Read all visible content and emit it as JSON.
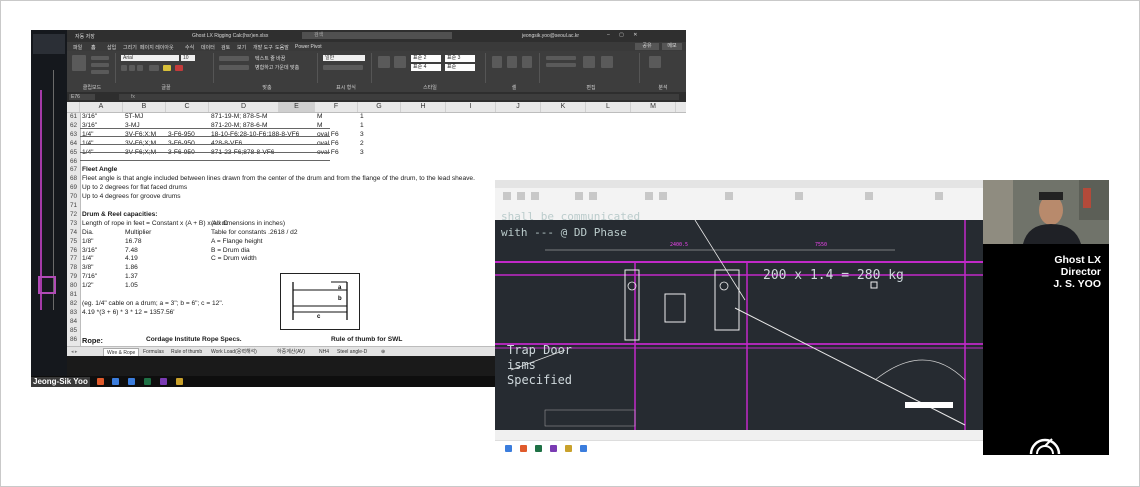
{
  "excel": {
    "window_title": "Ghost LX Rigging Calc(hsr)en.xlsx",
    "search_placeholder": "검색",
    "account": "jeongsik.yoo@seoul.ac.kr",
    "autosave": "자동 저장",
    "menu": [
      "파일",
      "홈",
      "삽입",
      "그리기",
      "페이지 레이아웃",
      "수식",
      "데이터",
      "검토",
      "보기",
      "개발 도구",
      "도움말",
      "Power Pivot"
    ],
    "share": "공유",
    "comment": "메모",
    "ribbon": {
      "clipboard": "클립보드",
      "paste": "붙여넣기",
      "font_group": "글꼴",
      "font_name": "Arial",
      "font_size": "10",
      "align_group": "맞춤",
      "wrap": "텍스트 줄 바꿈",
      "merge": "병합하고 가운데 맞춤",
      "number_group": "표시 형식",
      "number_format": "일반",
      "style_group": "스타일",
      "cond_format": "조건부 서식",
      "table_format": "표 서식",
      "styles": [
        "표준 2",
        "표준 3",
        "표준 4",
        "표준"
      ],
      "cells_group": "셀",
      "insert": "삽입",
      "delete": "삭제",
      "format": "서식",
      "edit_group": "편집",
      "sort": "정렬 및 필터",
      "find": "찾기 및 선택",
      "analysis": "분석",
      "data_analysis": "데이터 분석"
    },
    "name_box": "E76",
    "columns": [
      "A",
      "B",
      "C",
      "D",
      "E",
      "F",
      "G",
      "H",
      "I",
      "J",
      "K",
      "L",
      "M"
    ],
    "selected_column": "E",
    "rows": [
      {
        "n": "61",
        "cells": [
          "3/16\"",
          "5T-MJ",
          "",
          "871-19-M; 878-5-M",
          "",
          "M",
          "1"
        ]
      },
      {
        "n": "62",
        "cells": [
          "3/16\"",
          "3-MJ",
          "",
          "871-20-M; 878-6-M",
          "",
          "M",
          "1"
        ]
      },
      {
        "n": "63",
        "cells": [
          "1/4\"",
          "3V-F6;X;M",
          "3-F6-950",
          "18-10-F6;28-10-F6;188-8-VF6",
          "",
          "oval F6",
          "3"
        ]
      },
      {
        "n": "64",
        "cells": [
          "1/4\"",
          "3V-F6;X;M",
          "3-F6-950",
          "428-8-VF6",
          "",
          "oval F6",
          "2"
        ]
      },
      {
        "n": "65",
        "cells": [
          "1/4\"",
          "3V-F6;X;M",
          "3-F6-950",
          "871-23-F6;878-8-VF6",
          "",
          "oval F6",
          "3"
        ]
      },
      {
        "n": "66",
        "cells": []
      },
      {
        "n": "67",
        "cells": [
          "Fleet Angle"
        ]
      },
      {
        "n": "68",
        "cells": [
          "Fleet angle is that angle included between lines drawn from the center of the drum and from the flange of the drum, to the lead sheave."
        ]
      },
      {
        "n": "69",
        "cells": [
          "Up to 2 degrees for flat faced drums"
        ]
      },
      {
        "n": "70",
        "cells": [
          "Up to 4 degrees for groove drums"
        ]
      },
      {
        "n": "71",
        "cells": []
      },
      {
        "n": "72",
        "cells": [
          "Drum & Reel capacities:"
        ]
      },
      {
        "n": "73",
        "cells": [
          "Length of rope in feet = Constant x (A + B) x A x C",
          "",
          "",
          "(all dimensions in inches)"
        ]
      },
      {
        "n": "74",
        "cells": [
          "Dia.",
          "Multiplier",
          "",
          "Table for constants .2618 / d2"
        ]
      },
      {
        "n": "75",
        "cells": [
          "1/8\"",
          "16.78",
          "",
          "A = Flange height"
        ]
      },
      {
        "n": "76",
        "cells": [
          "3/16\"",
          "7.48",
          "",
          "B = Drum dia"
        ]
      },
      {
        "n": "77",
        "cells": [
          "1/4\"",
          "4.19",
          "",
          "C = Drum width"
        ]
      },
      {
        "n": "78",
        "cells": [
          "3/8\"",
          "1.86"
        ]
      },
      {
        "n": "79",
        "cells": [
          "7/16\"",
          "1.37"
        ]
      },
      {
        "n": "80",
        "cells": [
          "1/2\"",
          "1.05"
        ]
      },
      {
        "n": "81",
        "cells": []
      },
      {
        "n": "82",
        "cells": [
          "(eg. 1/4\" cable on a drum; a = 3\"; b = 6\"; c = 12\"."
        ]
      },
      {
        "n": "83",
        "cells": [
          "4.19 *(3 + 6) * 3 * 12 = 1357.56'"
        ]
      },
      {
        "n": "84",
        "cells": []
      },
      {
        "n": "85",
        "cells": []
      },
      {
        "n": "86",
        "cells": [
          "Rope:",
          "Cordage Institute Rope Specs.",
          "",
          "Rule of thumb for SWL"
        ]
      }
    ],
    "drum_labels": {
      "a": "a",
      "b": "b",
      "c": "c"
    },
    "sheet_tabs": [
      "Wire & Rope",
      "Formulas",
      "Rule of thumb",
      "Work Load(응력해석)",
      "하중계산(AV)",
      "NH4",
      "Steel angle-D",
      "⊕"
    ],
    "active_sheet": "Wire & Rope"
  },
  "left_participant": {
    "name": "Jeong-Sik Yoo"
  },
  "cad": {
    "note_top_line1": "shall be communicated",
    "note_top_line2": "with --- @ DD Phase",
    "dimension_label": "200 x 1.4 = 280 kg",
    "dim_top_1": "2400.5",
    "dim_top_2": "7550",
    "note_left_1": "Trap Door",
    "note_left_2": "isms",
    "note_left_3": "Specified"
  },
  "presenter": {
    "line1": "Ghost LX",
    "line2": "Director",
    "line3": "J. S. YOO"
  },
  "colors": {
    "accent_orange": "#f39200",
    "cad_magenta": "#c229c9",
    "cad_background": "#262b31"
  }
}
